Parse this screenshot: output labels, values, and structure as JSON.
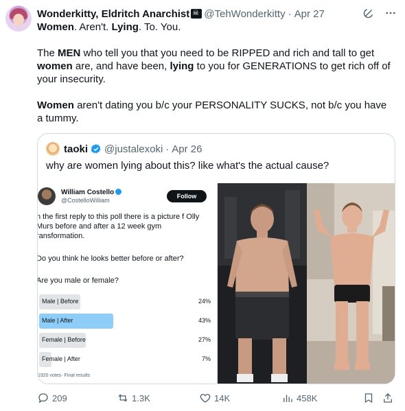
{
  "tweet": {
    "display_name": "Wonderkitty, Eldritch Anarchist",
    "handle": "@TehWonderkitty",
    "separator": "·",
    "date": "Apr 27",
    "paragraphs": [
      [
        {
          "t": "Women",
          "b": true
        },
        {
          "t": ". Aren't. ",
          "b": false
        },
        {
          "t": "Lying",
          "b": true
        },
        {
          "t": ". To. You.",
          "b": false
        }
      ],
      [
        {
          "t": "The ",
          "b": false
        },
        {
          "t": "MEN",
          "b": true
        },
        {
          "t": " who tell you that you need to be RIPPED and rich and tall to get ",
          "b": false
        },
        {
          "t": "women",
          "b": true
        },
        {
          "t": " are, and have been, ",
          "b": false
        },
        {
          "t": "lying",
          "b": true
        },
        {
          "t": " to you for GENERATIONS to get rich off of your insecurity.",
          "b": false
        }
      ],
      [
        {
          "t": "Women",
          "b": true
        },
        {
          "t": " aren't dating you b/c your PERSONALITY SUCKS, not b/c you have a tummy.",
          "b": false
        }
      ]
    ]
  },
  "quote": {
    "display_name": "taoki",
    "handle": "@justalexoki",
    "separator": "·",
    "date": "Apr 26",
    "text": "why are women lying about this? like what's the actual cause?",
    "poll_screenshot": {
      "name": "William Costello",
      "handle": "@CostelloWilliam",
      "follow_label": "Follow",
      "body": "n the first reply to this poll there is a picture f Olly Murs before and after a 12 week gym ransformation.",
      "question1": "Do you think he looks better before or after?",
      "question2": "Are you male or female?",
      "options": [
        {
          "label": "Male | Before",
          "pct": "24%",
          "value": 24,
          "leading": false
        },
        {
          "label": "Male | After",
          "pct": "43%",
          "value": 43,
          "leading": true
        },
        {
          "label": "Female | Before",
          "pct": "27%",
          "value": 27,
          "leading": false
        },
        {
          "label": "Female | After",
          "pct": "7%",
          "value": 7,
          "leading": false
        }
      ],
      "footer": "1920 votes· Final results"
    }
  },
  "actions": {
    "replies": "209",
    "reposts": "1.3K",
    "likes": "14K",
    "views": "458K"
  },
  "colors": {
    "verified": "#1d9bf0",
    "text_secondary": "#536471",
    "poll_leading": "#8ecdf7",
    "poll_other": "#e1e5e8"
  }
}
